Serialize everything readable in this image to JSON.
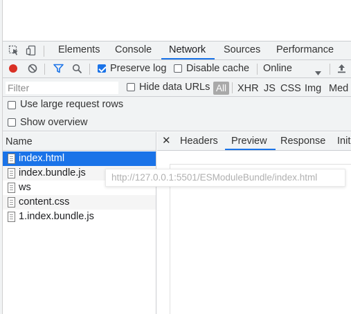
{
  "devtools": {
    "tabs": [
      {
        "label": "Elements"
      },
      {
        "label": "Console"
      },
      {
        "label": "Network"
      },
      {
        "label": "Sources"
      },
      {
        "label": "Performance"
      }
    ],
    "active_tab": "Network",
    "accent_color": "#1a73e8"
  },
  "toolbar": {
    "preserve_log_label": "Preserve log",
    "preserve_log_checked": true,
    "disable_cache_label": "Disable cache",
    "disable_cache_checked": false,
    "throttling_value": "Online"
  },
  "filter_bar": {
    "filter_placeholder": "Filter",
    "hide_data_urls_label": "Hide data URLs",
    "hide_data_urls_checked": false,
    "types": [
      "All",
      "XHR",
      "JS",
      "CSS",
      "Img",
      "Med"
    ],
    "active_type": "All"
  },
  "options": {
    "large_rows_label": "Use large request rows",
    "overview_label": "Show overview"
  },
  "request_list": {
    "header": "Name",
    "rows": [
      {
        "name": "index.html"
      },
      {
        "name": "index.bundle.js"
      },
      {
        "name": "ws"
      },
      {
        "name": "content.css"
      },
      {
        "name": "1.index.bundle.js"
      }
    ],
    "selected": "index.html"
  },
  "detail": {
    "tabs": [
      {
        "label": "Headers"
      },
      {
        "label": "Preview"
      },
      {
        "label": "Response"
      },
      {
        "label": "Init"
      }
    ],
    "active_tab": "Preview",
    "tooltip_url": "http://127.0.0.1:5501/ESModuleBundle/index.html"
  }
}
